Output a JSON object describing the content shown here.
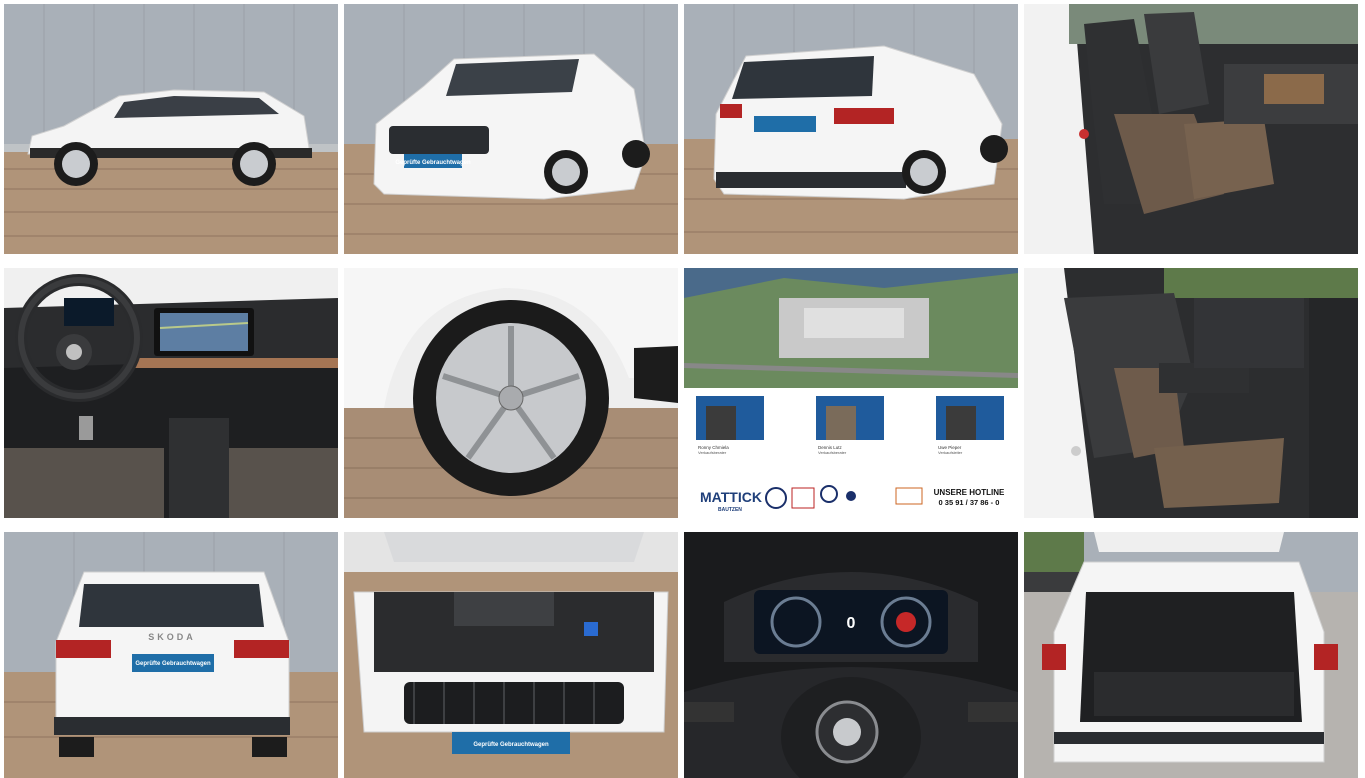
{
  "gallery": {
    "tiles": [
      {
        "name": "side-view"
      },
      {
        "name": "front-three-quarter-view"
      },
      {
        "name": "rear-three-quarter-view"
      },
      {
        "name": "front-seats-interior"
      },
      {
        "name": "dashboard-cockpit"
      },
      {
        "name": "wheel-rim-closeup"
      },
      {
        "name": "dealer-info-card"
      },
      {
        "name": "rear-seats-interior"
      },
      {
        "name": "rear-view"
      },
      {
        "name": "engine-bay"
      },
      {
        "name": "instrument-cluster"
      },
      {
        "name": "trunk-open"
      }
    ],
    "plate_text": "Geprüfte Gebrauchtwagen",
    "rear_badge": "SKODA",
    "cluster_value": "0",
    "dealer": {
      "logo_text": "MATTICK",
      "logo_sub": "BAUTZEN",
      "hotline_title": "UNSERE HOTLINE",
      "hotline_number": "0 35 91 / 37 86 - 0",
      "contacts": [
        {
          "name": "Ronny Chmiela",
          "role": "Verkaufsberater"
        },
        {
          "name": "Dennis Lutz",
          "role": "Verkaufsberater"
        },
        {
          "name": "Uwe Pieper",
          "role": "Verkaufsleiter"
        }
      ]
    }
  }
}
